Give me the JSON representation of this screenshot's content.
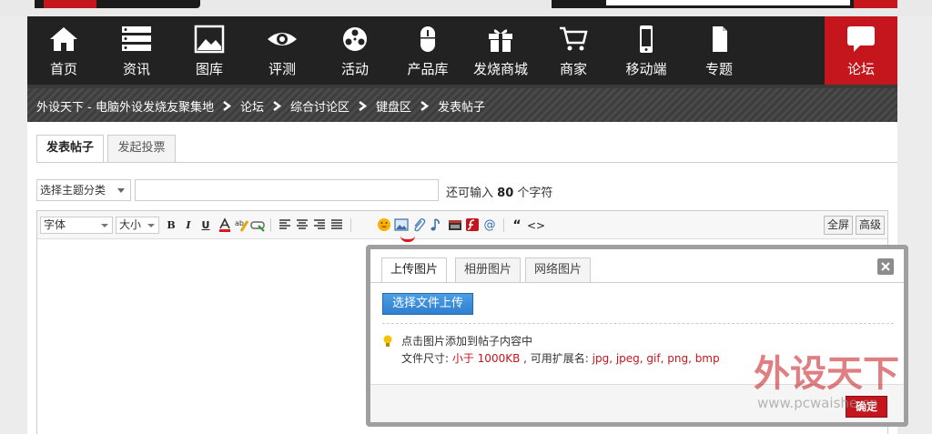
{
  "nav": {
    "items": [
      {
        "label": "首页",
        "icon": "home-icon"
      },
      {
        "label": "资讯",
        "icon": "news-icon"
      },
      {
        "label": "图库",
        "icon": "gallery-icon"
      },
      {
        "label": "评测",
        "icon": "eye-icon"
      },
      {
        "label": "活动",
        "icon": "activity-icon"
      },
      {
        "label": "产品库",
        "icon": "mouse-icon"
      },
      {
        "label": "发烧商城",
        "icon": "gift-icon"
      },
      {
        "label": "商家",
        "icon": "cart-icon"
      },
      {
        "label": "移动端",
        "icon": "phone-icon"
      },
      {
        "label": "专题",
        "icon": "document-icon"
      }
    ],
    "forum": {
      "label": "论坛",
      "icon": "chat-icon"
    }
  },
  "breadcrumb": [
    "外设天下 - 电脑外设发烧友聚集地",
    "论坛",
    "综合讨论区",
    "键盘区",
    "发表帖子"
  ],
  "tabs": [
    "发表帖子",
    "发起投票"
  ],
  "subject": {
    "select": "选择主题分类",
    "input_value": "",
    "hint_prefix": "还可输入",
    "hint_count": "80",
    "hint_suffix": "个字符"
  },
  "toolbar": {
    "font": "字体",
    "size": "大小",
    "bold": "B",
    "italic": "I",
    "underline": "U",
    "fullscreen": "全屏",
    "advanced": "高级",
    "quote": "“",
    "code": "<>",
    "at": "@"
  },
  "dialog": {
    "tabs": [
      "上传图片",
      "相册图片",
      "网络图片"
    ],
    "upload_button": "选择文件上传",
    "tip_line1": "点击图片添加到帖子内容中",
    "tip_line2_prefix": "文件尺寸: ",
    "tip_size": "小于 1000KB",
    "tip_mid": " , 可用扩展名: ",
    "tip_ext": "jpg, jpeg, gif, png, bmp",
    "ok_button": "确定"
  },
  "watermark": {
    "text": "外设天下",
    "url": "www.pcwaishe.cn"
  },
  "colors": {
    "brand_red": "#c4161c",
    "nav_bg": "#222222",
    "link_blue": "#2e7fd0"
  }
}
